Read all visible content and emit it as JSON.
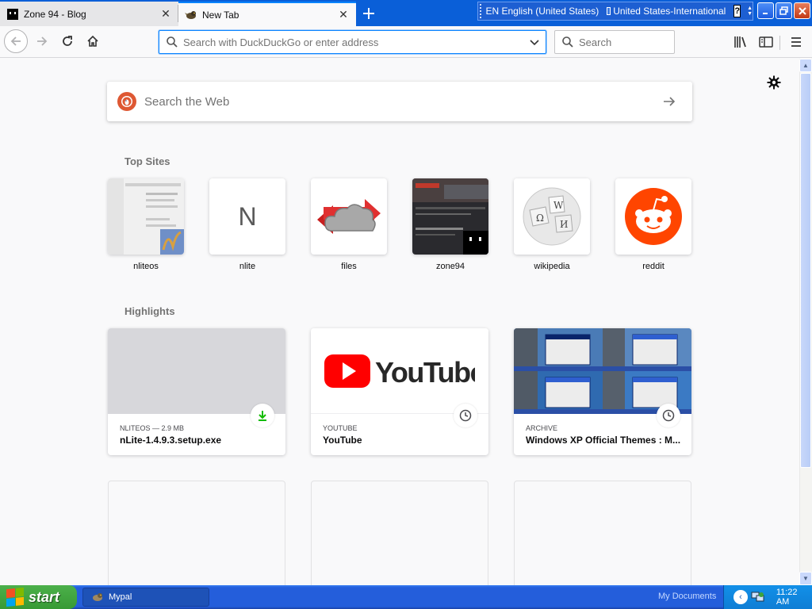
{
  "tabs": [
    {
      "title": "Zone 94 - Blog",
      "icon": "zone94-favicon",
      "active": false
    },
    {
      "title": "New Tab",
      "icon": "mypal-favicon",
      "active": true
    }
  ],
  "language_bar": {
    "language": "EN English (United States)",
    "keyboard": "United States-International",
    "help": "?"
  },
  "navbar": {
    "url_placeholder": "Search with DuckDuckGo or enter address",
    "search_placeholder": "Search"
  },
  "newtab": {
    "search_placeholder": "Search the Web",
    "top_sites_title": "Top Sites",
    "highlights_title": "Highlights",
    "top_sites": [
      {
        "label": "nliteos"
      },
      {
        "label": "nlite",
        "letter": "N"
      },
      {
        "label": "files"
      },
      {
        "label": "zone94"
      },
      {
        "label": "wikipedia"
      },
      {
        "label": "reddit"
      }
    ],
    "highlights": [
      {
        "meta": "NLITEOS — 2.9 MB",
        "title": "nLite-1.4.9.3.setup.exe",
        "badge": "download-icon"
      },
      {
        "meta": "YOUTUBE",
        "title": "YouTube",
        "badge": "clock-icon",
        "logo_text": "YouTube"
      },
      {
        "meta": "ARCHIVE",
        "title": "Windows XP Official Themes : M...",
        "badge": "clock-icon"
      }
    ]
  },
  "taskbar": {
    "start_label": "start",
    "task_label": "Mypal",
    "my_documents": "My Documents",
    "clock": "11:22 AM"
  },
  "colors": {
    "accent": "#0a84ff",
    "reddit": "#ff4500",
    "youtube": "#ff0000",
    "xp_blue": "#245edb",
    "xp_green": "#379a35"
  }
}
